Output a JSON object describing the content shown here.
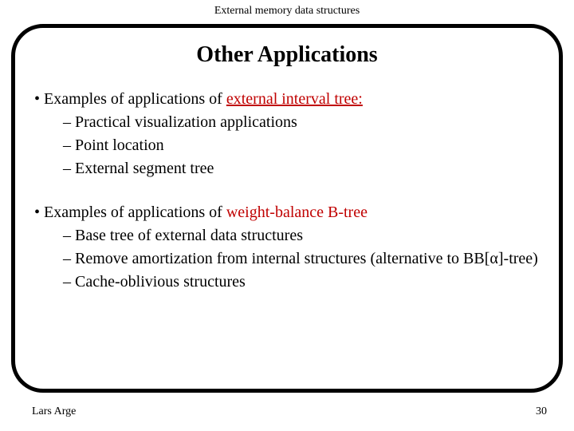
{
  "header": "External memory data structures",
  "title": "Other Applications",
  "block1": {
    "intro_prefix": "Examples of applications of ",
    "intro_link": "external interval tree:",
    "items": [
      "Practical visualization applications",
      "Point location",
      "External segment tree"
    ]
  },
  "block2": {
    "intro_prefix": "Examples of applications of ",
    "intro_link": "weight-balance B-tree",
    "items": [
      "Base tree of external data structures",
      "Remove amortization from internal structures (alternative to BB[α]-tree)",
      "Cache-oblivious structures"
    ]
  },
  "footer": {
    "author": "Lars Arge",
    "page": "30"
  }
}
